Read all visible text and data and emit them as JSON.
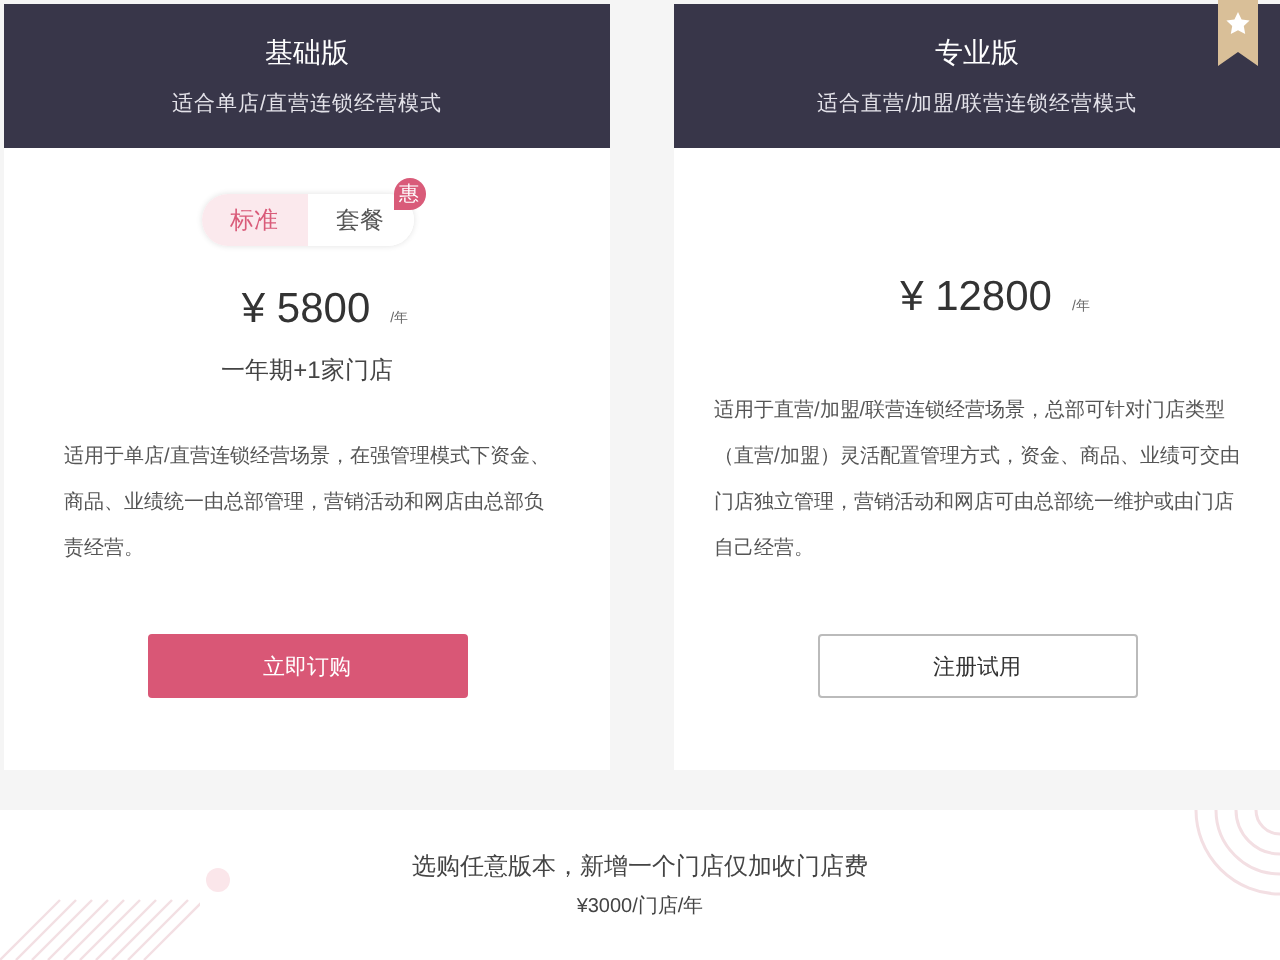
{
  "plans": [
    {
      "title": "基础版",
      "subtitle": "适合单店/直营连锁经营模式",
      "ribbon": false,
      "tabs": [
        {
          "label": "标准",
          "selected": true
        },
        {
          "label": "套餐",
          "selected": false,
          "badge": "惠"
        }
      ],
      "price": "¥ 5800",
      "unit": "/年",
      "note": "一年期+1家门店",
      "description": "适用于单店/直营连锁经营场景，在强管理模式下资金、商品、业绩统一由总部管理，营销活动和网店由总部负责经营。",
      "button": {
        "label": "立即订购",
        "kind": "primary"
      }
    },
    {
      "title": "专业版",
      "subtitle": "适合直营/加盟/联营连锁经营模式",
      "ribbon": true,
      "price": "¥ 12800",
      "unit": "/年",
      "description": "适用于直营/加盟/联营连锁经营场景，总部可针对门店类型（直营/加盟）灵活配置管理方式，资金、商品、业绩可交由门店独立管理，营销活动和网店可由总部统一维护或由门店自己经营。",
      "button": {
        "label": "注册试用",
        "kind": "outline"
      }
    }
  ],
  "footer": {
    "text": "选购任意版本，新增一个门店仅加收门店费",
    "price": "¥3000/门店/年"
  }
}
